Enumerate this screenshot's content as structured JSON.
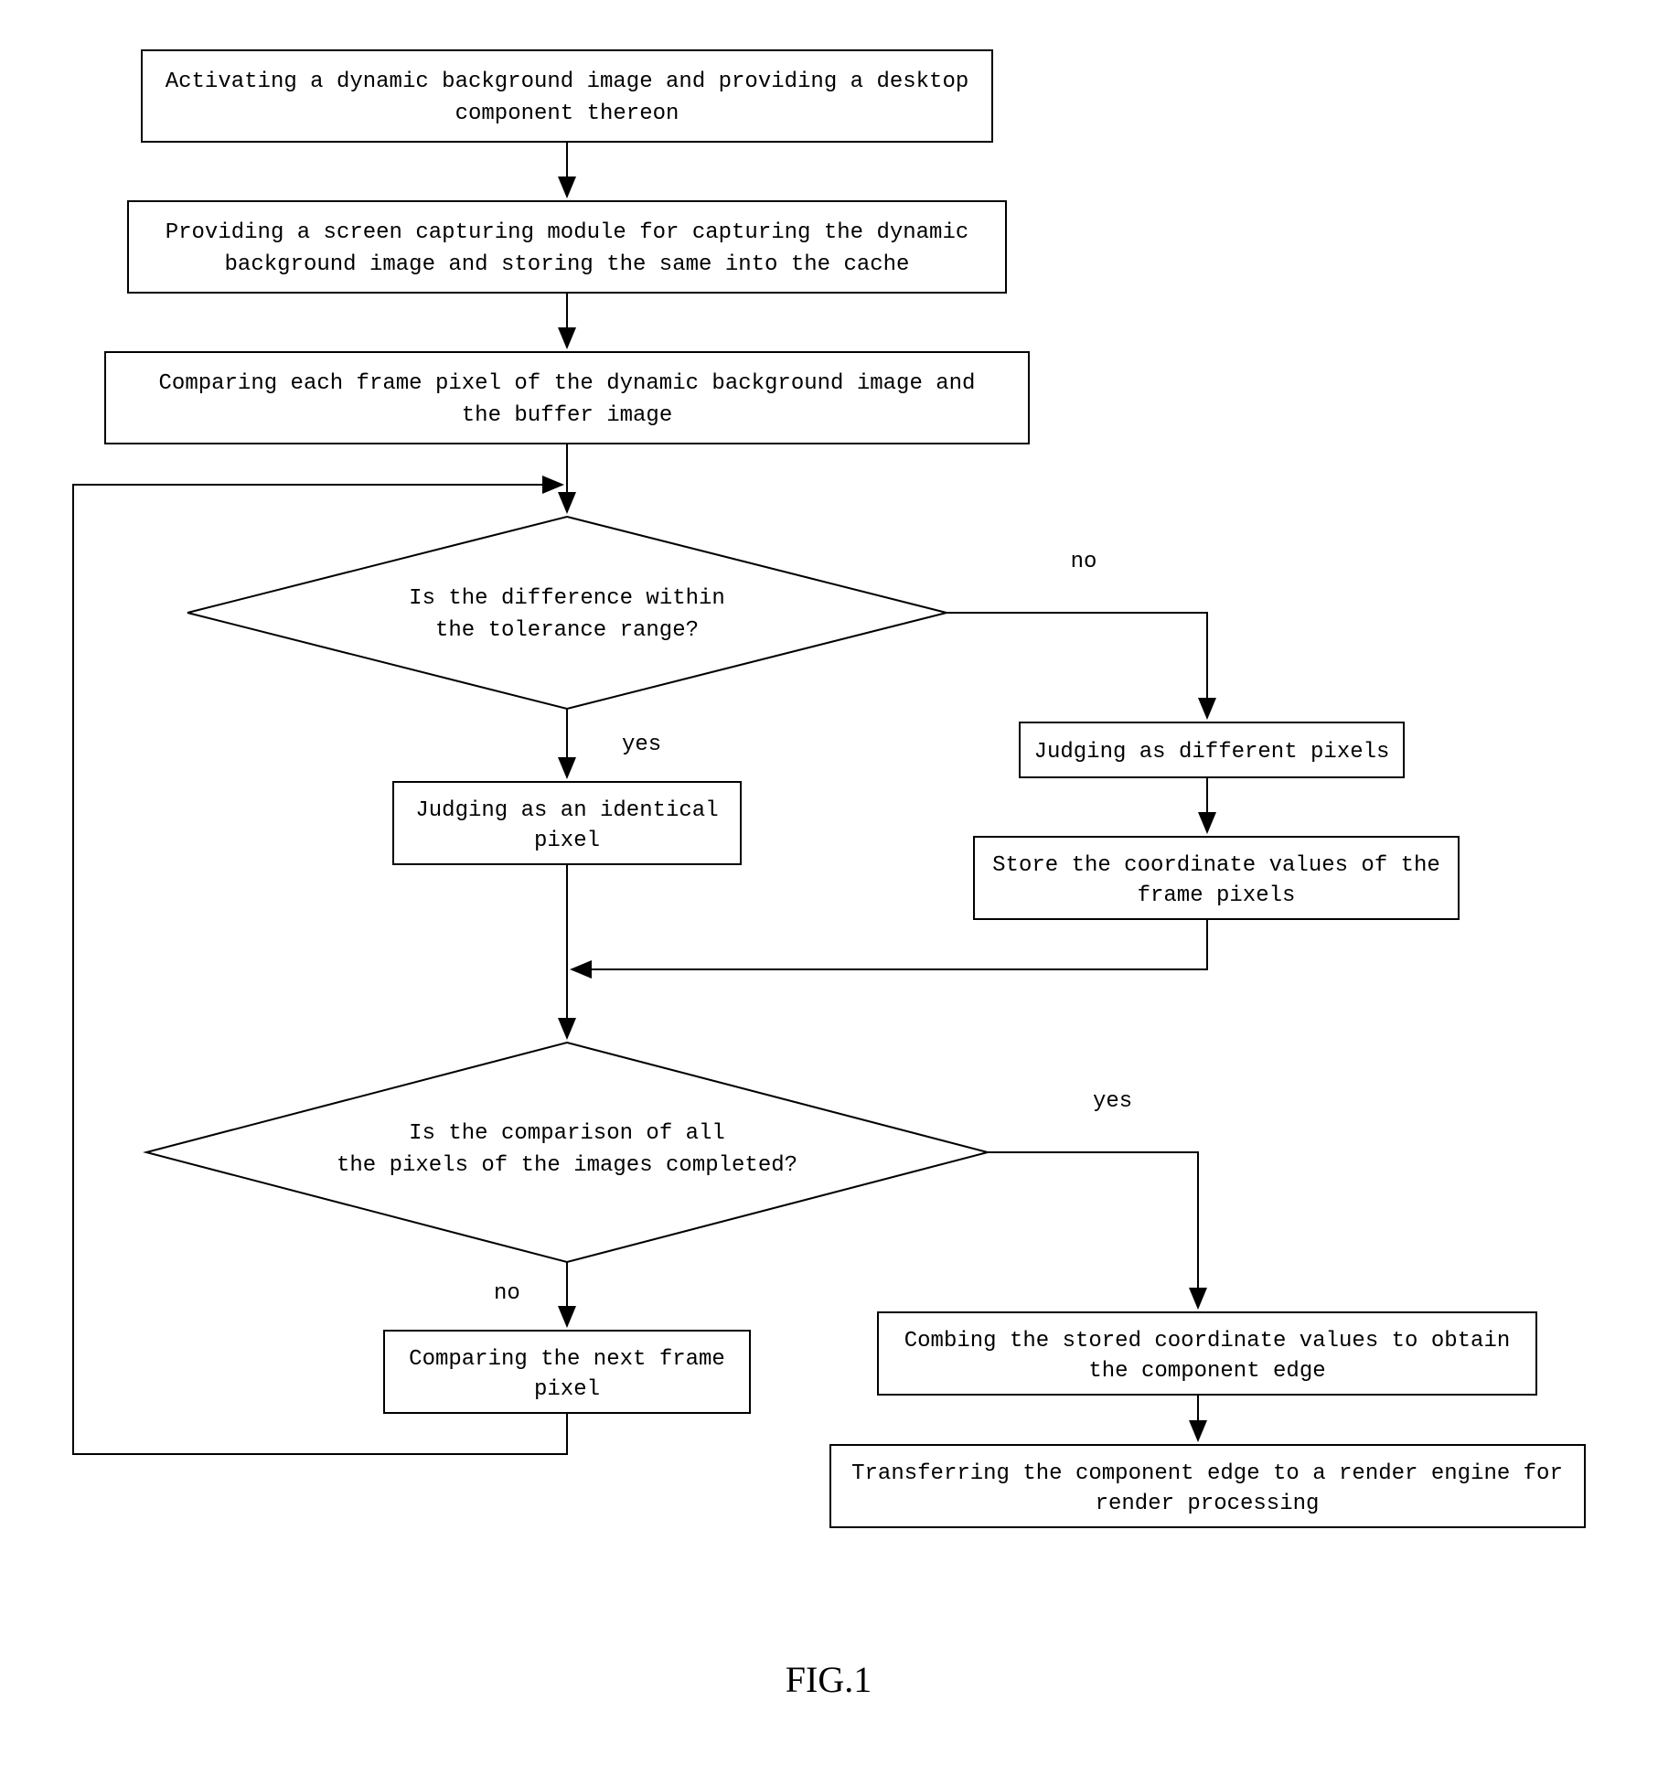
{
  "flowchart": {
    "box1_line1": "Activating a dynamic background image and providing a desktop",
    "box1_line2": "component thereon",
    "box2_line1": "Providing a screen capturing module for capturing the dynamic",
    "box2_line2": "background image and storing the same into the cache",
    "box3_line1": "Comparing each frame pixel of the dynamic background image and",
    "box3_line2": "the buffer image",
    "diamond1_line1": "Is the difference within",
    "diamond1_line2": "the tolerance range?",
    "box4_line1": "Judging as an identical",
    "box4_line2": "pixel",
    "box5": "Judging as different pixels",
    "box6_line1": "Store the coordinate values of the",
    "box6_line2": "frame pixels",
    "diamond2_line1": "Is the comparison of all",
    "diamond2_line2": "the pixels of the images completed?",
    "box7_line1": "Comparing the next frame",
    "box7_line2": "pixel",
    "box8_line1": "Combing the stored coordinate values to obtain",
    "box8_line2": "the component edge",
    "box9_line1": "Transferring the component edge to a render engine for",
    "box9_line2": "render processing",
    "label_yes": "yes",
    "label_no": "no",
    "figure_label": "FIG.1"
  }
}
